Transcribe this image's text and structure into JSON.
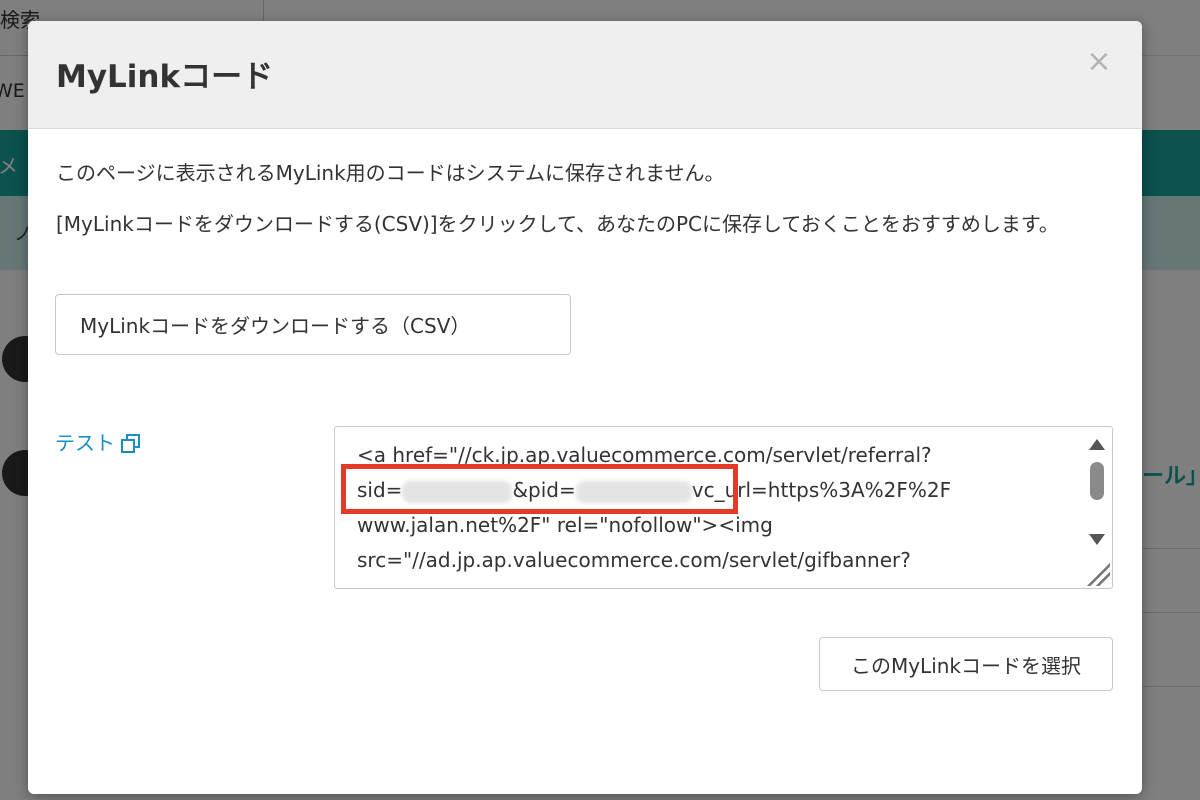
{
  "background": {
    "tab_label": "検索",
    "web_label": "WE",
    "bar1_text": "メ",
    "bar2_text": "ノ",
    "right_text": "ール」"
  },
  "modal": {
    "title": "MyLinkコード",
    "close_icon": "×",
    "desc1": "このページに表示されるMyLink用のコードはシステムに保存されません。",
    "desc2": "[MyLinkコードをダウンロードする(CSV)]をクリックして、あなたのPCに保存しておくことをおすすめします。",
    "csv_button_label": "MyLinkコードをダウンロードする（CSV）",
    "test_link_label": "テスト",
    "code": {
      "line1": "<a href=\"//ck.jp.ap.valuecommerce.com/servlet/referral?",
      "line2_a": "sid=",
      "line2_b": "&pid=",
      "line2_c": "vc_url=https%3A%2F%2F",
      "line3": "www.jalan.net%2F\" rel=\"nofollow\"><img",
      "line4": "src=\"//ad.jp.ap.valuecommerce.com/servlet/gifbanner?"
    },
    "select_button_label": "このMyLinkコードを選択"
  },
  "colors": {
    "accent_teal": "#16a39a",
    "link_blue": "#1a8fc4",
    "highlight_red": "#e43b28"
  },
  "icons": {
    "close": "close-icon",
    "external_link": "external-link-icon"
  }
}
